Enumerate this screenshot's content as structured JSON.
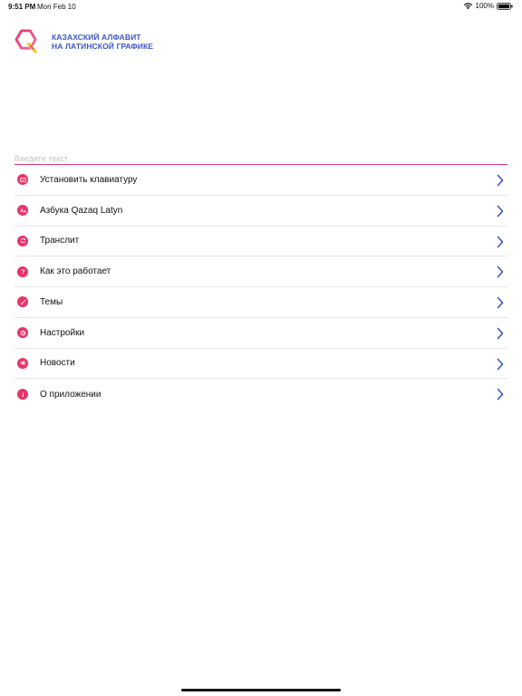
{
  "status_bar": {
    "time": "9:51 PM",
    "date": "Mon Feb 10",
    "battery": "100%",
    "icons": [
      "wifi-icon",
      "battery-icon"
    ]
  },
  "header": {
    "logo_icon": "app-logo-icon",
    "title_line1": "КАЗАХСКИЙ АЛФАВИТ",
    "title_line2": "НА ЛАТИНСКОЙ ГРАФИКЕ"
  },
  "search": {
    "value": "",
    "placeholder": "Введите текст"
  },
  "menu": {
    "items": [
      {
        "label": "Установить клавиатуру",
        "icon": "keyboard-icon"
      },
      {
        "label": "Азбука Qazaq Latyn",
        "icon": "alphabet-icon"
      },
      {
        "label": "Транслит",
        "icon": "translit-icon"
      },
      {
        "label": "Как это работает",
        "icon": "question-icon"
      },
      {
        "label": "Темы",
        "icon": "brush-icon"
      },
      {
        "label": "Настройки",
        "icon": "gear-icon"
      },
      {
        "label": "Новости",
        "icon": "news-icon"
      },
      {
        "label": "О приложении",
        "icon": "info-icon"
      }
    ],
    "chevron_icon": "chevron-right-icon"
  },
  "colors": {
    "accent": "#e7356a",
    "title": "#3b56c4",
    "chevron": "#3b56c4",
    "divider": "#e6e6e6"
  }
}
